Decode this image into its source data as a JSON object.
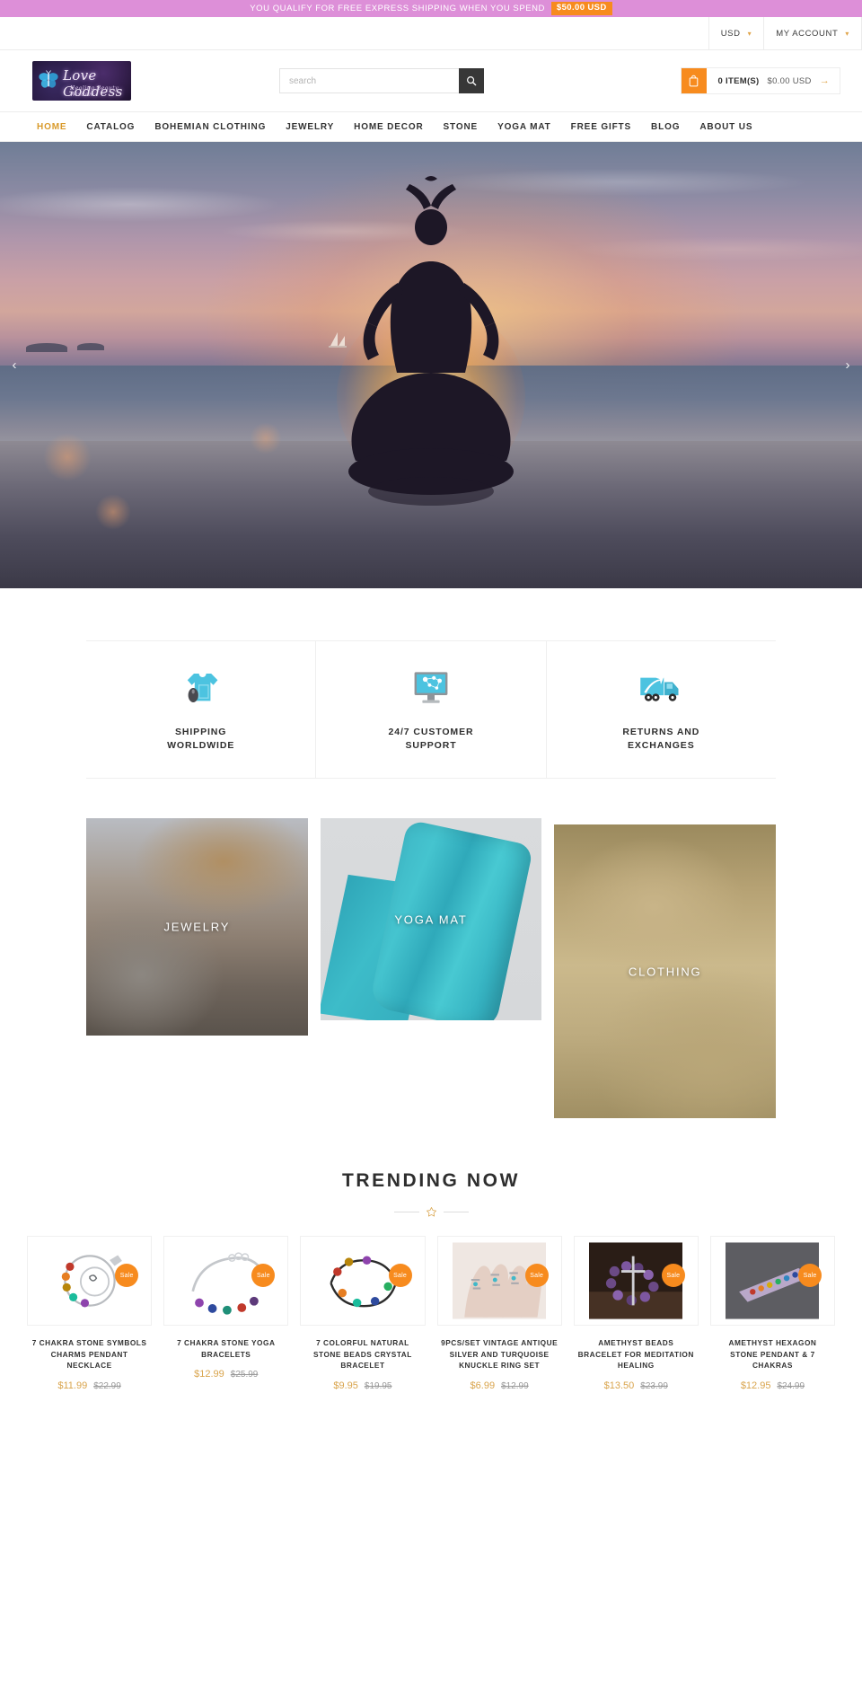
{
  "promo": {
    "text": "YOU QUALIFY FOR FREE EXPRESS SHIPPING WHEN YOU SPEND",
    "amount": "$50.00 USD",
    "badge_color": "#f78b1e",
    "bar_color": "#dd8fd8"
  },
  "utility": {
    "currency": "USD",
    "account": "MY ACCOUNT"
  },
  "brand": {
    "wordmark": "Love Goddess",
    "tagline": "Healing Beauty Wisdom"
  },
  "search": {
    "placeholder": "search",
    "value": ""
  },
  "cart": {
    "count_label": "0 ITEM(S)",
    "total": "$0.00 USD"
  },
  "nav": {
    "items": [
      {
        "label": "HOME",
        "active": true
      },
      {
        "label": "CATALOG",
        "active": false
      },
      {
        "label": "BOHEMIAN CLOTHING",
        "active": false
      },
      {
        "label": "JEWELRY",
        "active": false
      },
      {
        "label": "HOME DECOR",
        "active": false
      },
      {
        "label": "STONE",
        "active": false
      },
      {
        "label": "YOGA MAT",
        "active": false
      },
      {
        "label": "FREE GIFTS",
        "active": false
      },
      {
        "label": "BLOG",
        "active": false
      },
      {
        "label": "ABOUT US",
        "active": false
      }
    ]
  },
  "hero": {
    "prev_glyph": "‹",
    "next_glyph": "›",
    "alt": "Woman meditating in yoga pose on beach at sunset"
  },
  "services": [
    {
      "icon": "tshirt-mouse-icon",
      "line1": "SHIPPING",
      "line2": "WORLDWIDE"
    },
    {
      "icon": "monitor-support-icon",
      "line1": "24/7 CUSTOMER",
      "line2": "SUPPORT"
    },
    {
      "icon": "delivery-truck-icon",
      "line1": "RETURNS AND",
      "line2": "EXCHANGES"
    }
  ],
  "categories": [
    {
      "label": "JEWELRY"
    },
    {
      "label": "YOGA MAT"
    },
    {
      "label": "CLOTHING"
    }
  ],
  "trending": {
    "title": "TRENDING NOW",
    "divider_icon": "star-icon",
    "accent_color": "#d9a44c",
    "products": [
      {
        "name": "7 CHAKRA STONE SYMBOLS CHARMS PENDANT NECKLACE",
        "price": "$11.99",
        "compare_at": "$22.99",
        "badge": "Sale"
      },
      {
        "name": "7 CHAKRA STONE YOGA BRACELETS",
        "price": "$12.99",
        "compare_at": "$25.99",
        "badge": "Sale"
      },
      {
        "name": "7 COLORFUL NATURAL STONE BEADS CRYSTAL BRACELET",
        "price": "$9.95",
        "compare_at": "$19.95",
        "badge": "Sale"
      },
      {
        "name": "9PCS/SET VINTAGE ANTIQUE SILVER AND TURQUOISE KNUCKLE RING SET",
        "price": "$6.99",
        "compare_at": "$12.99",
        "badge": "Sale"
      },
      {
        "name": "AMETHYST BEADS BRACELET FOR MEDITATION HEALING",
        "price": "$13.50",
        "compare_at": "$23.99",
        "badge": "Sale"
      },
      {
        "name": "AMETHYST HEXAGON STONE PENDANT & 7 CHAKRAS",
        "price": "$12.95",
        "compare_at": "$24.99",
        "badge": "Sale"
      }
    ]
  }
}
